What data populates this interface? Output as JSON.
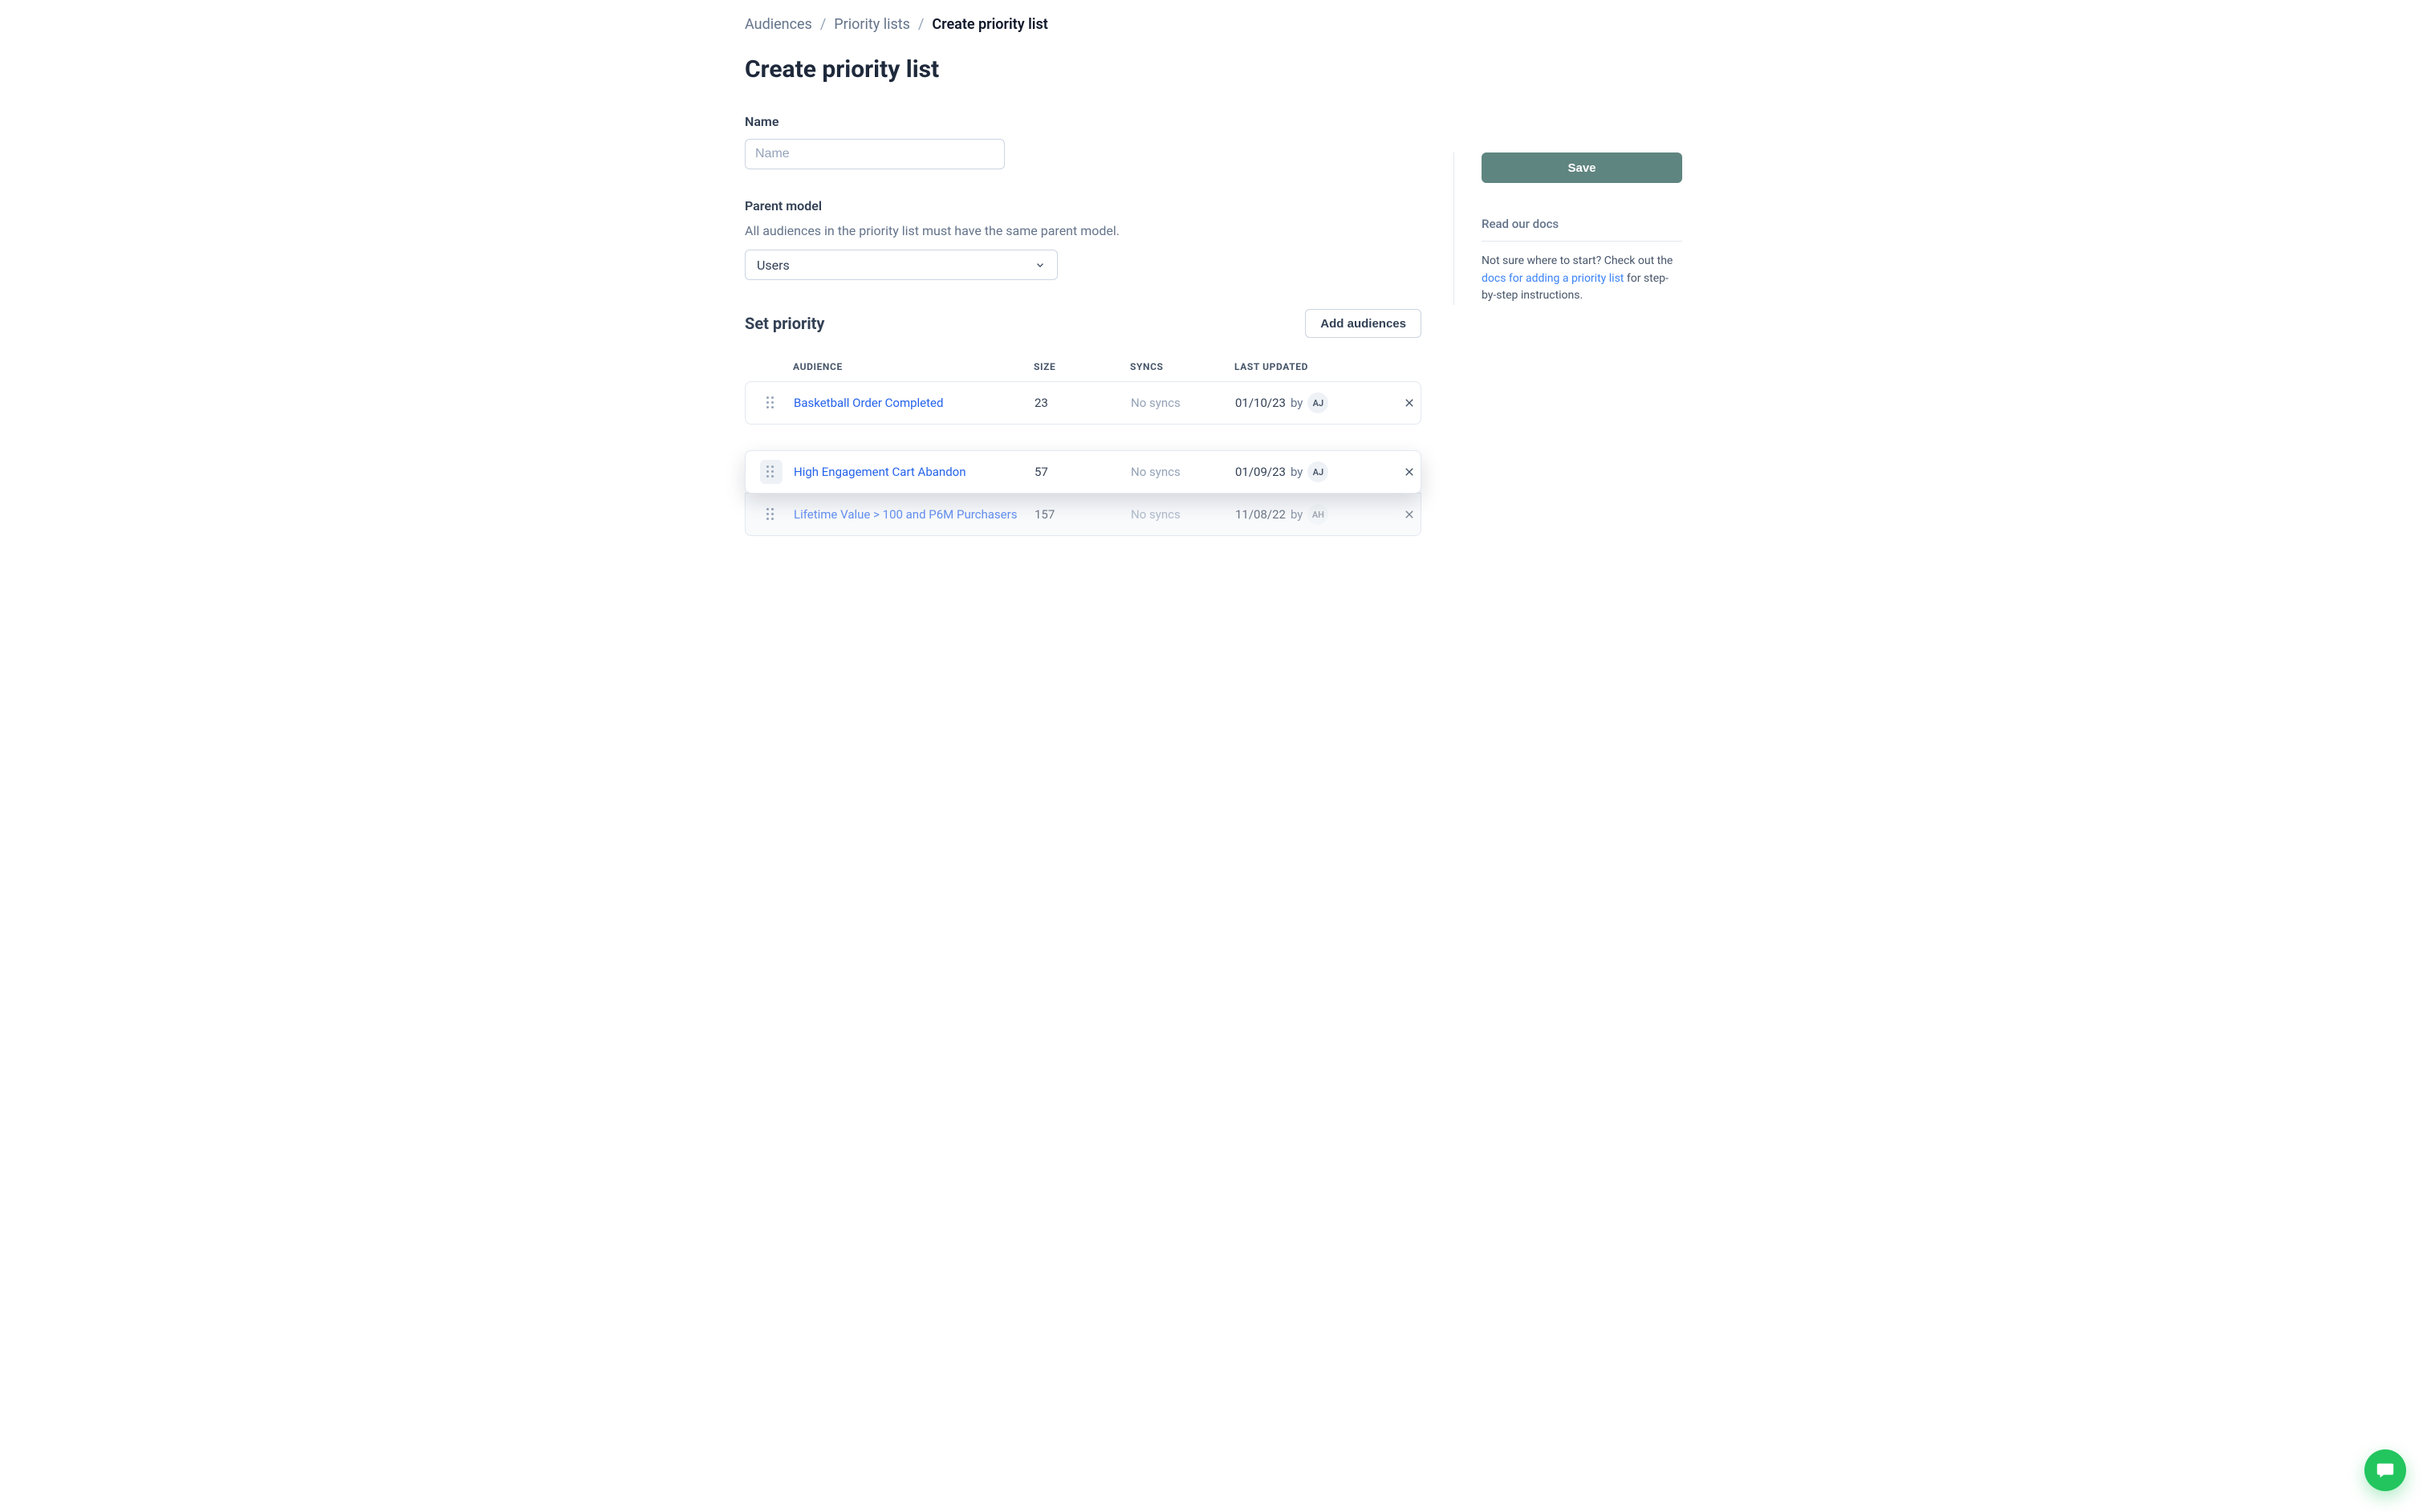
{
  "breadcrumb": {
    "items": [
      "Audiences",
      "Priority lists"
    ],
    "current": "Create priority list",
    "separator": "/"
  },
  "header": {
    "title": "Create priority list"
  },
  "form": {
    "name": {
      "label": "Name",
      "placeholder": "Name",
      "value": ""
    },
    "parent_model": {
      "label": "Parent model",
      "help": "All audiences in the priority list must have the same parent model.",
      "selected": "Users"
    }
  },
  "priority": {
    "title": "Set priority",
    "add_button_label": "Add audiences",
    "columns": {
      "audience": "AUDIENCE",
      "size": "SIZE",
      "syncs": "SYNCS",
      "updated": "LAST UPDATED"
    },
    "by_label": "by",
    "rows": [
      {
        "audience": "Basketball Order Completed",
        "size": "23",
        "syncs": "No syncs",
        "updated_date": "01/10/23",
        "updated_by_initials": "AJ",
        "state": "normal"
      },
      {
        "audience": "High Engagement Cart Abandon",
        "size": "57",
        "syncs": "No syncs",
        "updated_date": "01/09/23",
        "updated_by_initials": "AJ",
        "state": "dragging"
      },
      {
        "audience": "Lifetime Value > 100 and P6M Purchasers",
        "size": "157",
        "syncs": "No syncs",
        "updated_date": "11/08/22",
        "updated_by_initials": "AH",
        "state": "under-drag"
      }
    ]
  },
  "sidebar": {
    "save_label": "Save",
    "docs_header": "Read our docs",
    "docs_text_before": "Not sure where to start? Check out the ",
    "docs_link_text": "docs for adding a priority list",
    "docs_text_after": " for step-by-step instructions."
  },
  "colors": {
    "accent_button": "#5f8580",
    "link": "#2563eb",
    "chat": "#22c55e"
  }
}
